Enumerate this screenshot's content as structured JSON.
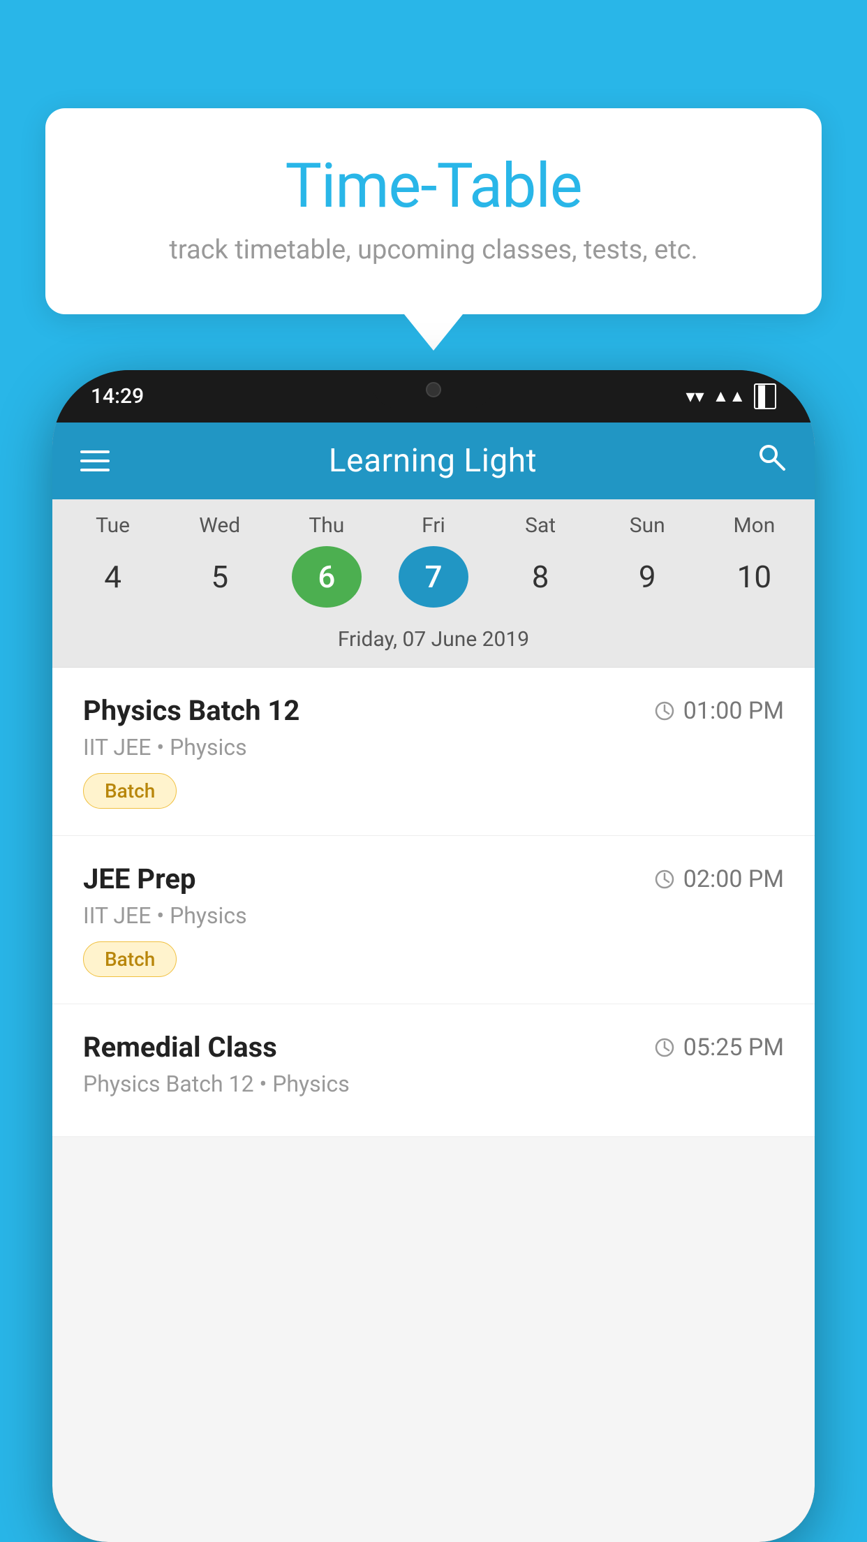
{
  "background_color": "#29B6E8",
  "tooltip": {
    "title": "Time-Table",
    "subtitle": "track timetable, upcoming classes, tests, etc."
  },
  "phone": {
    "status_bar": {
      "time": "14:29",
      "wifi": "▼",
      "signal": "▲",
      "battery": "■"
    },
    "app_bar": {
      "title": "Learning Light",
      "menu_label": "menu",
      "search_label": "search"
    },
    "calendar": {
      "days": [
        "Tue",
        "Wed",
        "Thu",
        "Fri",
        "Sat",
        "Sun",
        "Mon"
      ],
      "dates": [
        "4",
        "5",
        "6",
        "7",
        "8",
        "9",
        "10"
      ],
      "today_index": 2,
      "selected_index": 3,
      "selected_date_label": "Friday, 07 June 2019"
    },
    "schedule": [
      {
        "title": "Physics Batch 12",
        "time": "01:00 PM",
        "meta": "IIT JEE • Physics",
        "badge": "Batch"
      },
      {
        "title": "JEE Prep",
        "time": "02:00 PM",
        "meta": "IIT JEE • Physics",
        "badge": "Batch"
      },
      {
        "title": "Remedial Class",
        "time": "05:25 PM",
        "meta": "Physics Batch 12 • Physics",
        "badge": null
      }
    ]
  }
}
